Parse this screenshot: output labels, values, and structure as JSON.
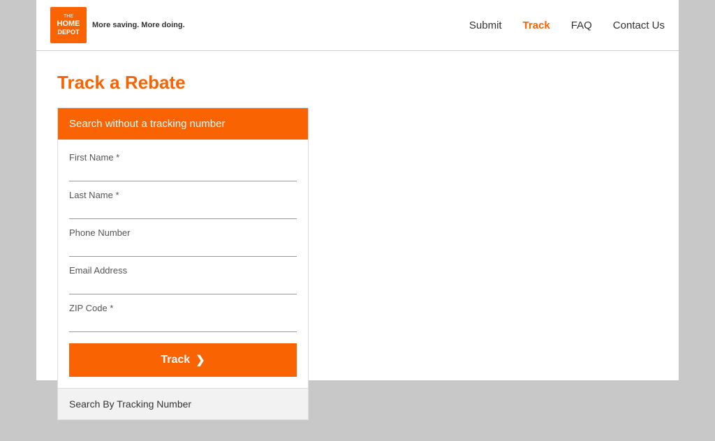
{
  "header": {
    "logo": {
      "the": "THE",
      "home": "HOME",
      "depot": "DEPOT"
    },
    "tagline": "More saving. More doing.",
    "tagline_bold_1": "More saving.",
    "tagline_bold_2": "More doing."
  },
  "nav": {
    "items": [
      {
        "label": "Submit",
        "active": false
      },
      {
        "label": "Track",
        "active": true
      },
      {
        "label": "FAQ",
        "active": false
      },
      {
        "label": "Contact Us",
        "active": false
      }
    ]
  },
  "page": {
    "title": "Track a Rebate",
    "form": {
      "header": "Search without a tracking number",
      "fields": [
        {
          "label": "First Name *",
          "placeholder": ""
        },
        {
          "label": "Last Name *",
          "placeholder": ""
        },
        {
          "label": "Phone Number",
          "placeholder": ""
        },
        {
          "label": "Email Address",
          "placeholder": ""
        },
        {
          "label": "ZIP Code *",
          "placeholder": ""
        }
      ],
      "track_button": "Track",
      "chevron": "❯",
      "search_by_tracking": "Search By Tracking Number"
    }
  }
}
